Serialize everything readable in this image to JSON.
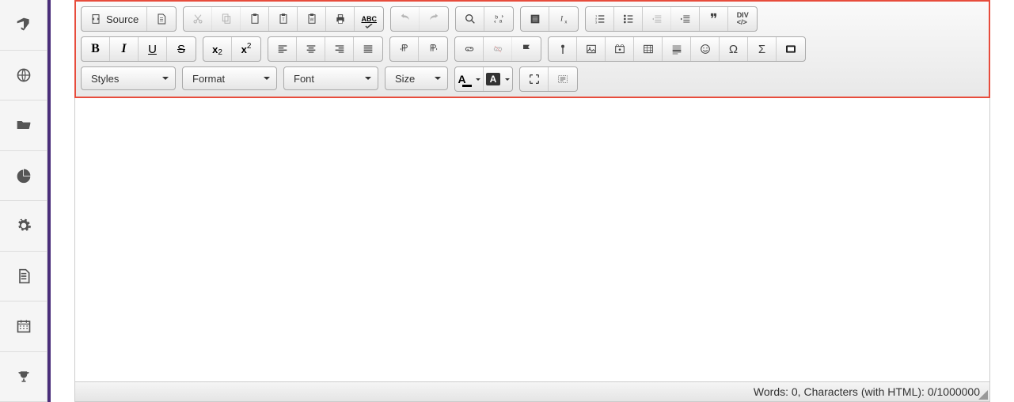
{
  "sidebar": {
    "items": [
      {
        "name": "announcements",
        "icon": "bullhorn"
      },
      {
        "name": "globe",
        "icon": "globe"
      },
      {
        "name": "files",
        "icon": "folder-open"
      },
      {
        "name": "reports",
        "icon": "pie-chart"
      },
      {
        "name": "settings",
        "icon": "gear"
      },
      {
        "name": "documents",
        "icon": "file-text"
      },
      {
        "name": "calendar",
        "icon": "calendar"
      },
      {
        "name": "achievements",
        "icon": "trophy"
      }
    ]
  },
  "toolbar": {
    "source_label": "Source",
    "bold": "B",
    "italic": "I",
    "underline": "U",
    "strike": "S",
    "subscript": "x",
    "superscript": "x",
    "text_color": "A",
    "bg_color": "A",
    "abc_label": "ABC",
    "quotes": "❞",
    "div_label": "DIV",
    "omega": "Ω",
    "sigma": "Σ"
  },
  "combos": {
    "styles": "Styles",
    "format": "Format",
    "font": "Font",
    "size": "Size"
  },
  "status": {
    "text": "Words: 0, Characters (with HTML): 0/1000000"
  }
}
